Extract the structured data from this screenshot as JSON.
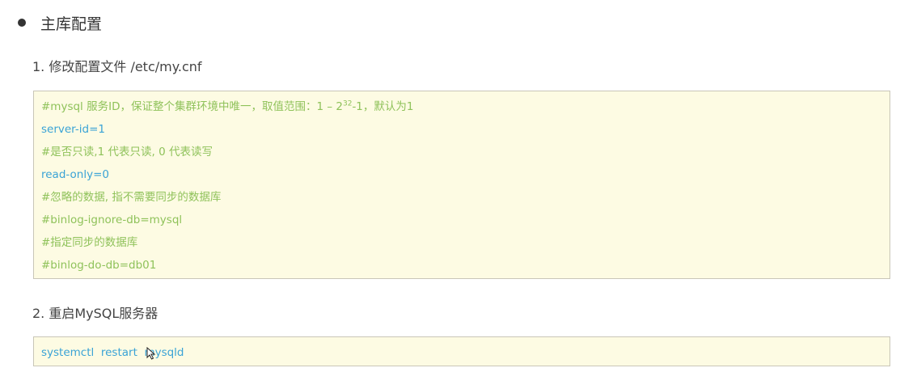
{
  "section_title": "主库配置",
  "steps": [
    {
      "label": "1. 修改配置文件 /etc/my.cnf",
      "lines": [
        {
          "type": "comment",
          "text": "#mysql 服务ID，保证整个集群环境中唯一，取值范围：1 – 2",
          "sup": "32",
          "tail": "-1，默认为1"
        },
        {
          "type": "code",
          "text": "server-id=1"
        },
        {
          "type": "comment",
          "text": "#是否只读,1 代表只读, 0 代表读写"
        },
        {
          "type": "code",
          "text": "read-only=0"
        },
        {
          "type": "comment",
          "text": "#忽略的数据, 指不需要同步的数据库"
        },
        {
          "type": "comment",
          "text": "#binlog-ignore-db=mysql"
        },
        {
          "type": "comment",
          "text": "#指定同步的数据库"
        },
        {
          "type": "comment",
          "text": "#binlog-do-db=db01"
        }
      ]
    },
    {
      "label": "2. 重启MySQL服务器",
      "lines": [
        {
          "type": "code",
          "text": "systemctl  restart  mysqld"
        }
      ]
    }
  ],
  "colors": {
    "comment": "#8fc25a",
    "code": "#3aa3d6",
    "code_background": "#fdfbe3"
  },
  "icons": [
    "bullet-icon",
    "mouse-cursor-icon"
  ]
}
